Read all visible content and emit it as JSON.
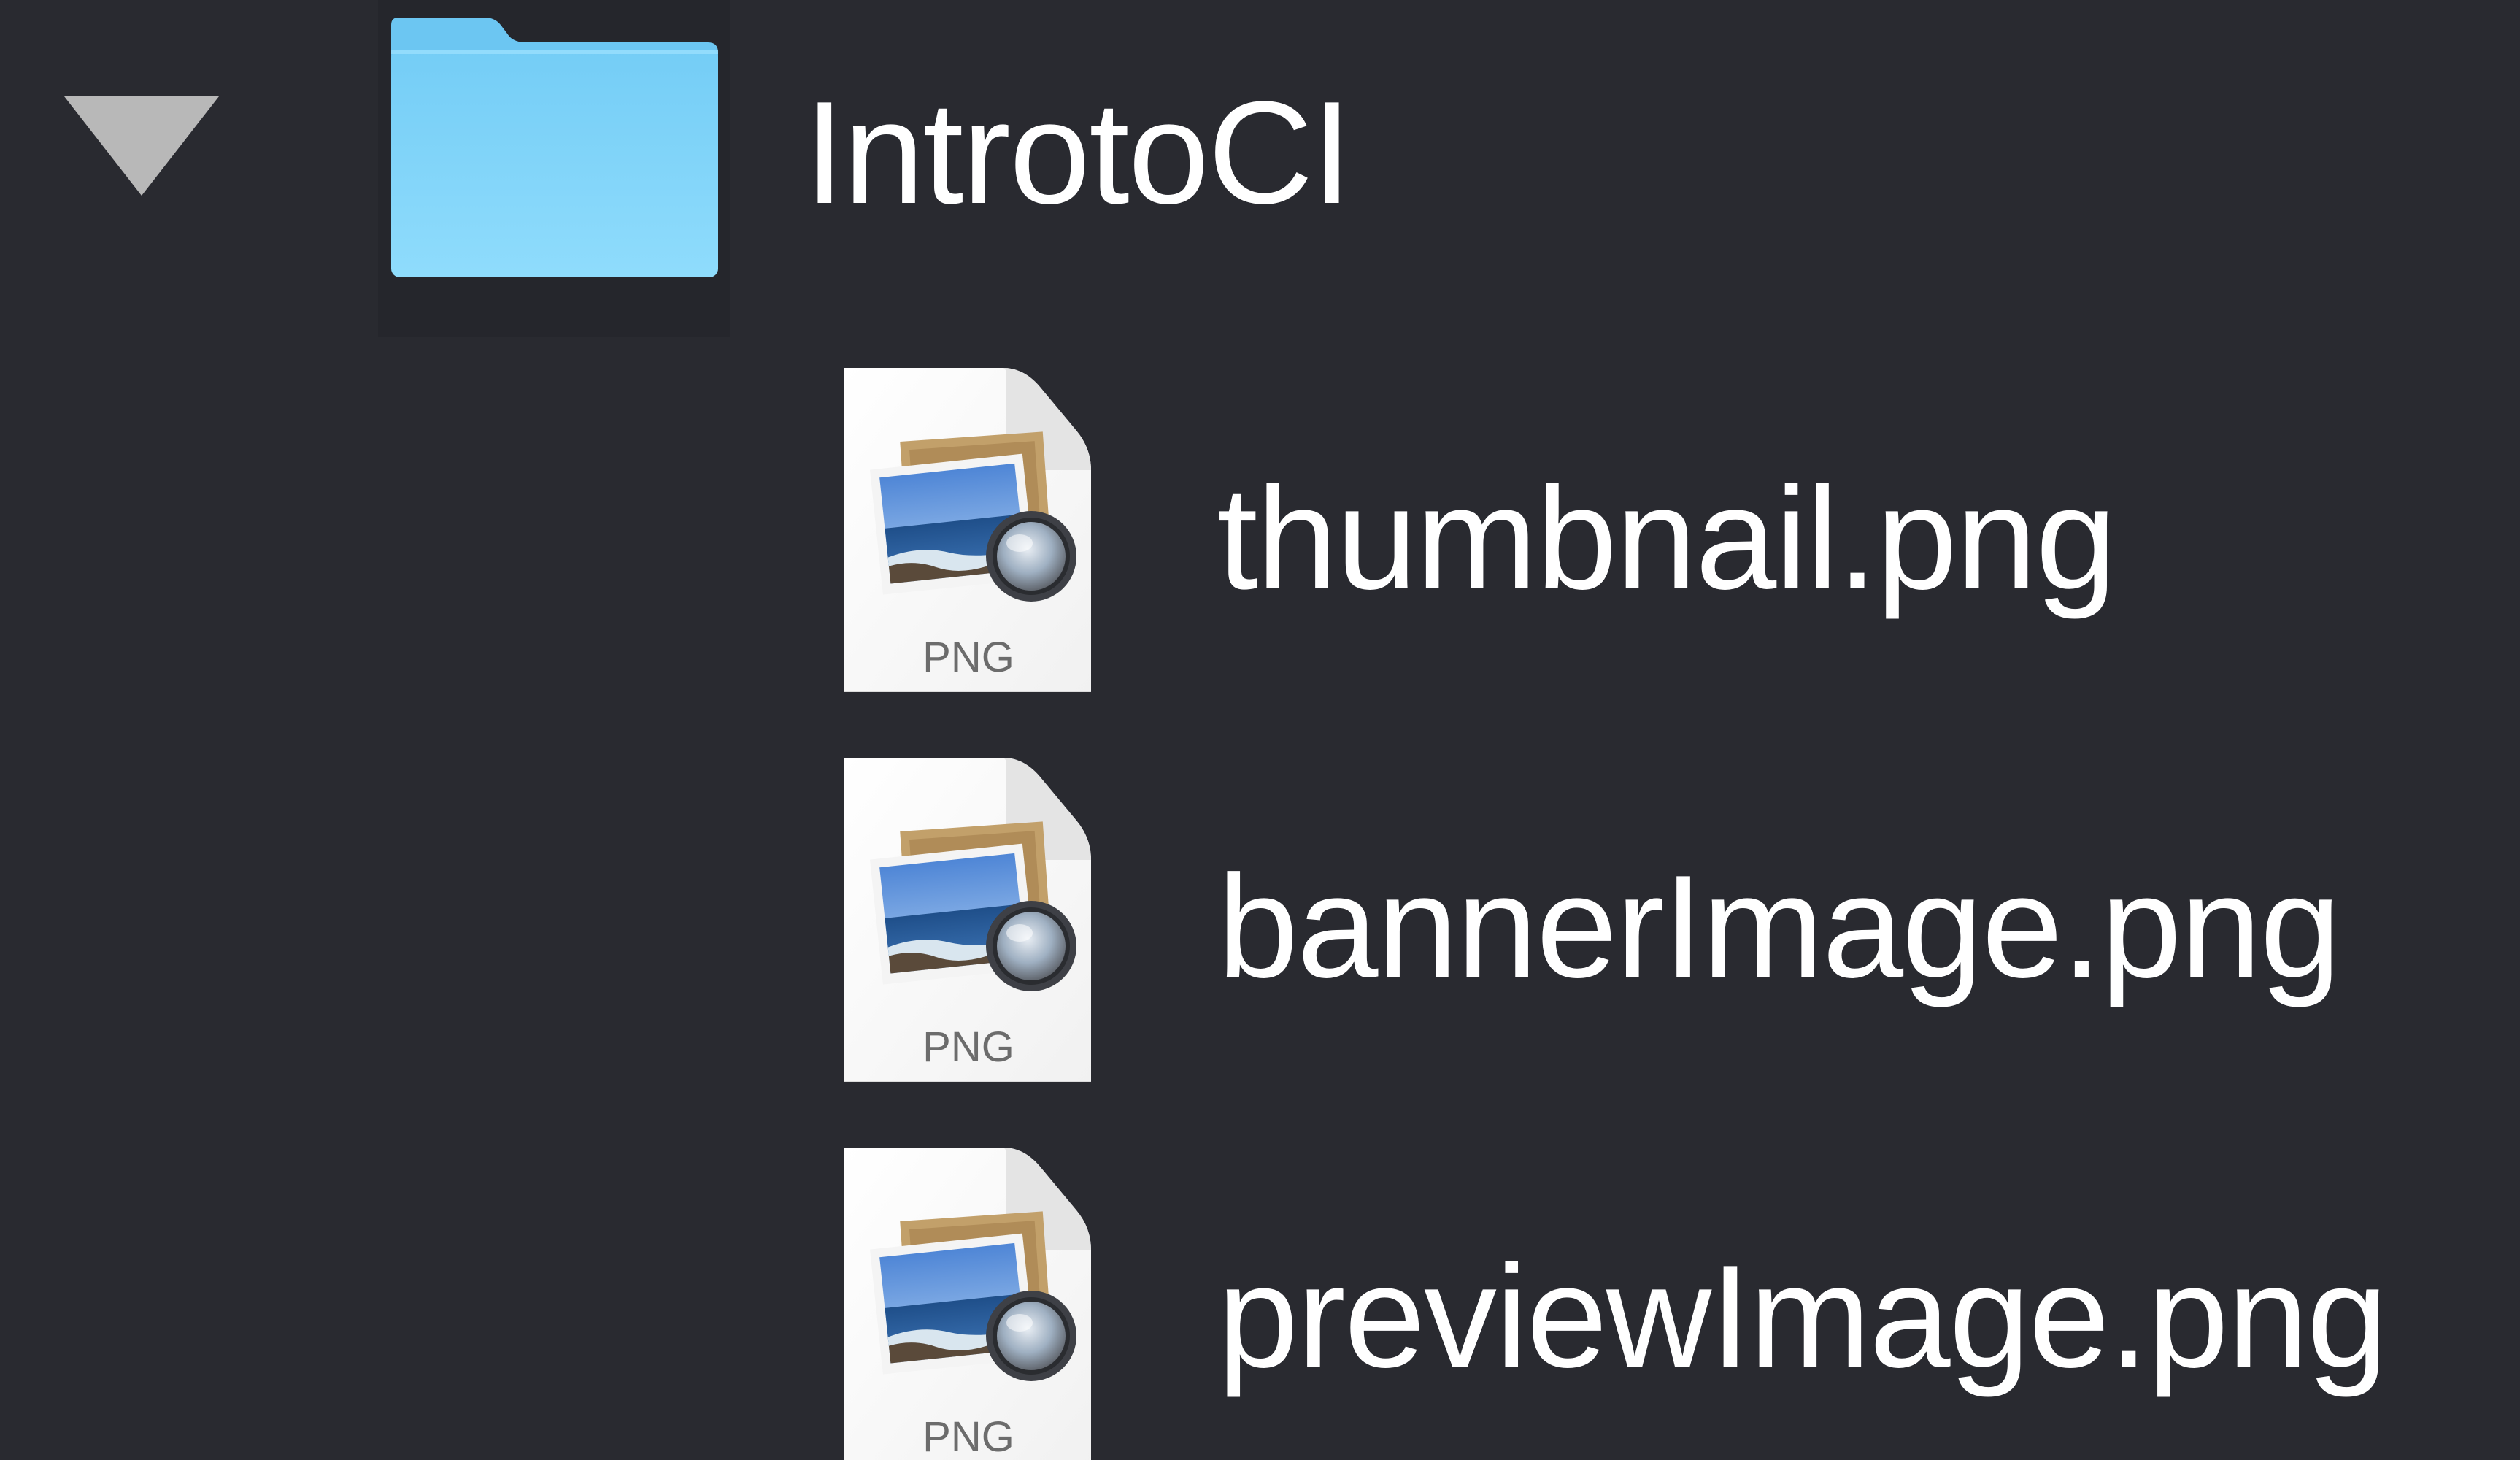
{
  "tree": {
    "folder": {
      "name": "IntrotoCI",
      "expanded": true,
      "disclosure_icon": "triangle-down-icon",
      "icon": "folder-icon",
      "color": "#7fd3f7"
    },
    "files": [
      {
        "name": "thumbnail.png",
        "icon": "png-file-icon",
        "badge": "PNG"
      },
      {
        "name": "bannerImage.png",
        "icon": "png-file-icon",
        "badge": "PNG"
      },
      {
        "name": "previewImage.png",
        "icon": "png-file-icon",
        "badge": "PNG"
      }
    ]
  },
  "colors": {
    "background": "#292a30",
    "text": "#ffffff",
    "disclosure": "#b8b8b8"
  }
}
